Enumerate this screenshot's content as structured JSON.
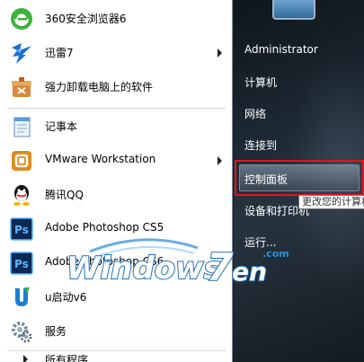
{
  "start_menu": {
    "programs": [
      {
        "label": "360安全浏览器6",
        "icon": "360-browser-icon",
        "has_submenu": false
      },
      {
        "label": "迅雷7",
        "icon": "thunder-icon",
        "has_submenu": true
      },
      {
        "label": "强力卸载电脑上的软件",
        "icon": "uninstall-icon",
        "has_submenu": false
      },
      {
        "label": "记事本",
        "icon": "notepad-icon",
        "has_submenu": false
      },
      {
        "label": "VMware Workstation",
        "icon": "vmware-icon",
        "has_submenu": true
      },
      {
        "label": "腾讯QQ",
        "icon": "qq-icon",
        "has_submenu": false
      },
      {
        "label": "Adobe Photoshop CS5",
        "icon": "photoshop-icon",
        "has_submenu": false
      },
      {
        "label": "Adobe Photoshop CS6",
        "icon": "photoshop-icon",
        "has_submenu": false
      },
      {
        "label": "u启动v6",
        "icon": "u-boot-icon",
        "has_submenu": false
      },
      {
        "label": "服务",
        "icon": "services-icon",
        "has_submenu": false
      }
    ],
    "all_programs_partial": "所有程序"
  },
  "right_pane": {
    "items": [
      "Administrator",
      "计算机",
      "网络",
      "连接到",
      "控制面板",
      "设备和打印机",
      "运行..."
    ],
    "highlighted": "控制面板",
    "tooltip": "更改您的计算机"
  },
  "watermark": {
    "brand": "Windows7en",
    "suffix": ".com"
  },
  "colors": {
    "highlight_border": "#e0141e",
    "ps_blue": "#0a2a55",
    "ps_text": "#5fb3ff"
  }
}
